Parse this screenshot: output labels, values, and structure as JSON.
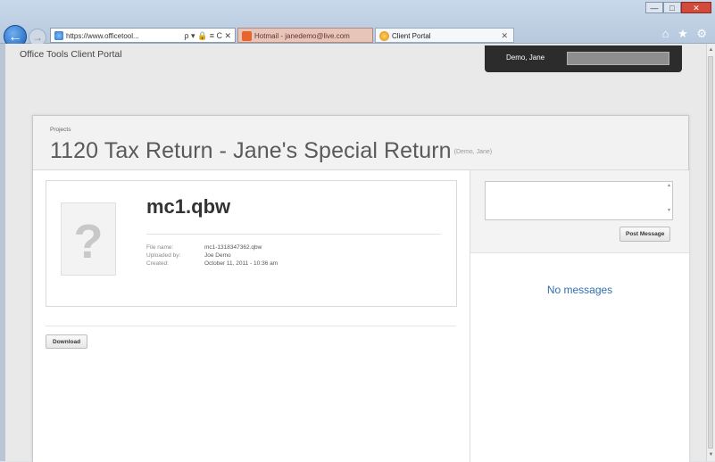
{
  "browser": {
    "address_url": "https://www.officetool...",
    "address_controls": "ρ ▾ 🔒 ≡ C ✕",
    "tabs": [
      {
        "label": "Hotmail - janedemo@live.com"
      },
      {
        "label": "Client Portal"
      }
    ],
    "window_buttons": {
      "minimize": "—",
      "maximize": "□",
      "close": "✕"
    },
    "right_tools": "⌂ ★ ⚙"
  },
  "portal": {
    "title": "Office Tools Client Portal",
    "user_name": "Demo, Jane"
  },
  "project": {
    "breadcrumb": "Projects",
    "title": "1120 Tax Return - Jane's Special Return",
    "client": "(Demo, Jane)"
  },
  "file": {
    "thumbnail_glyph": "?",
    "name": "mc1.qbw",
    "meta": [
      {
        "key": "File name:",
        "value": "mc1-1318347362.qbw"
      },
      {
        "key": "Uploaded by:",
        "value": "Joe Demo"
      },
      {
        "key": "Created:",
        "value": "October 11, 2011 - 10:36 am"
      }
    ],
    "download_label": "Download"
  },
  "messages": {
    "post_label": "Post Message",
    "empty_text": "No messages"
  },
  "colors": {
    "link_blue": "#2f6fb0",
    "userbar_bg": "#2c2c2c",
    "card_header_bg": "#f2f2f2"
  }
}
